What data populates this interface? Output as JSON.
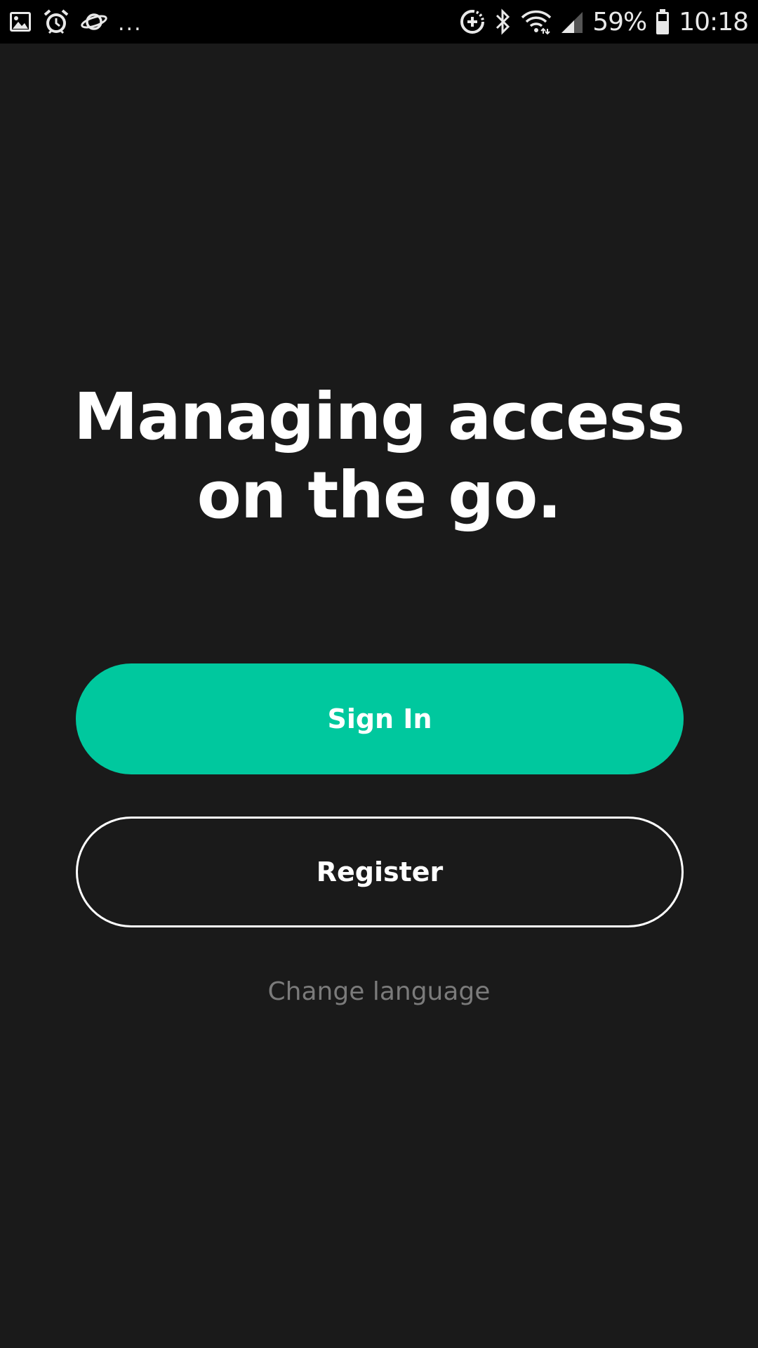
{
  "status_bar": {
    "left_icons": [
      "image-icon",
      "alarm-icon",
      "planet-icon"
    ],
    "overflow": "...",
    "right_icons": [
      "data-saver-icon",
      "bluetooth-icon",
      "wifi-icon",
      "signal-icon"
    ],
    "battery_percent": "59%",
    "time": "10:18"
  },
  "welcome": {
    "headline_line1": "Managing access",
    "headline_line2": "on the go."
  },
  "actions": {
    "sign_in_label": "Sign In",
    "register_label": "Register",
    "change_language_label": "Change language"
  },
  "colors": {
    "background": "#1a1a1a",
    "accent": "#00c89e",
    "text_primary": "#ffffff",
    "text_muted": "#7b7b7b"
  }
}
